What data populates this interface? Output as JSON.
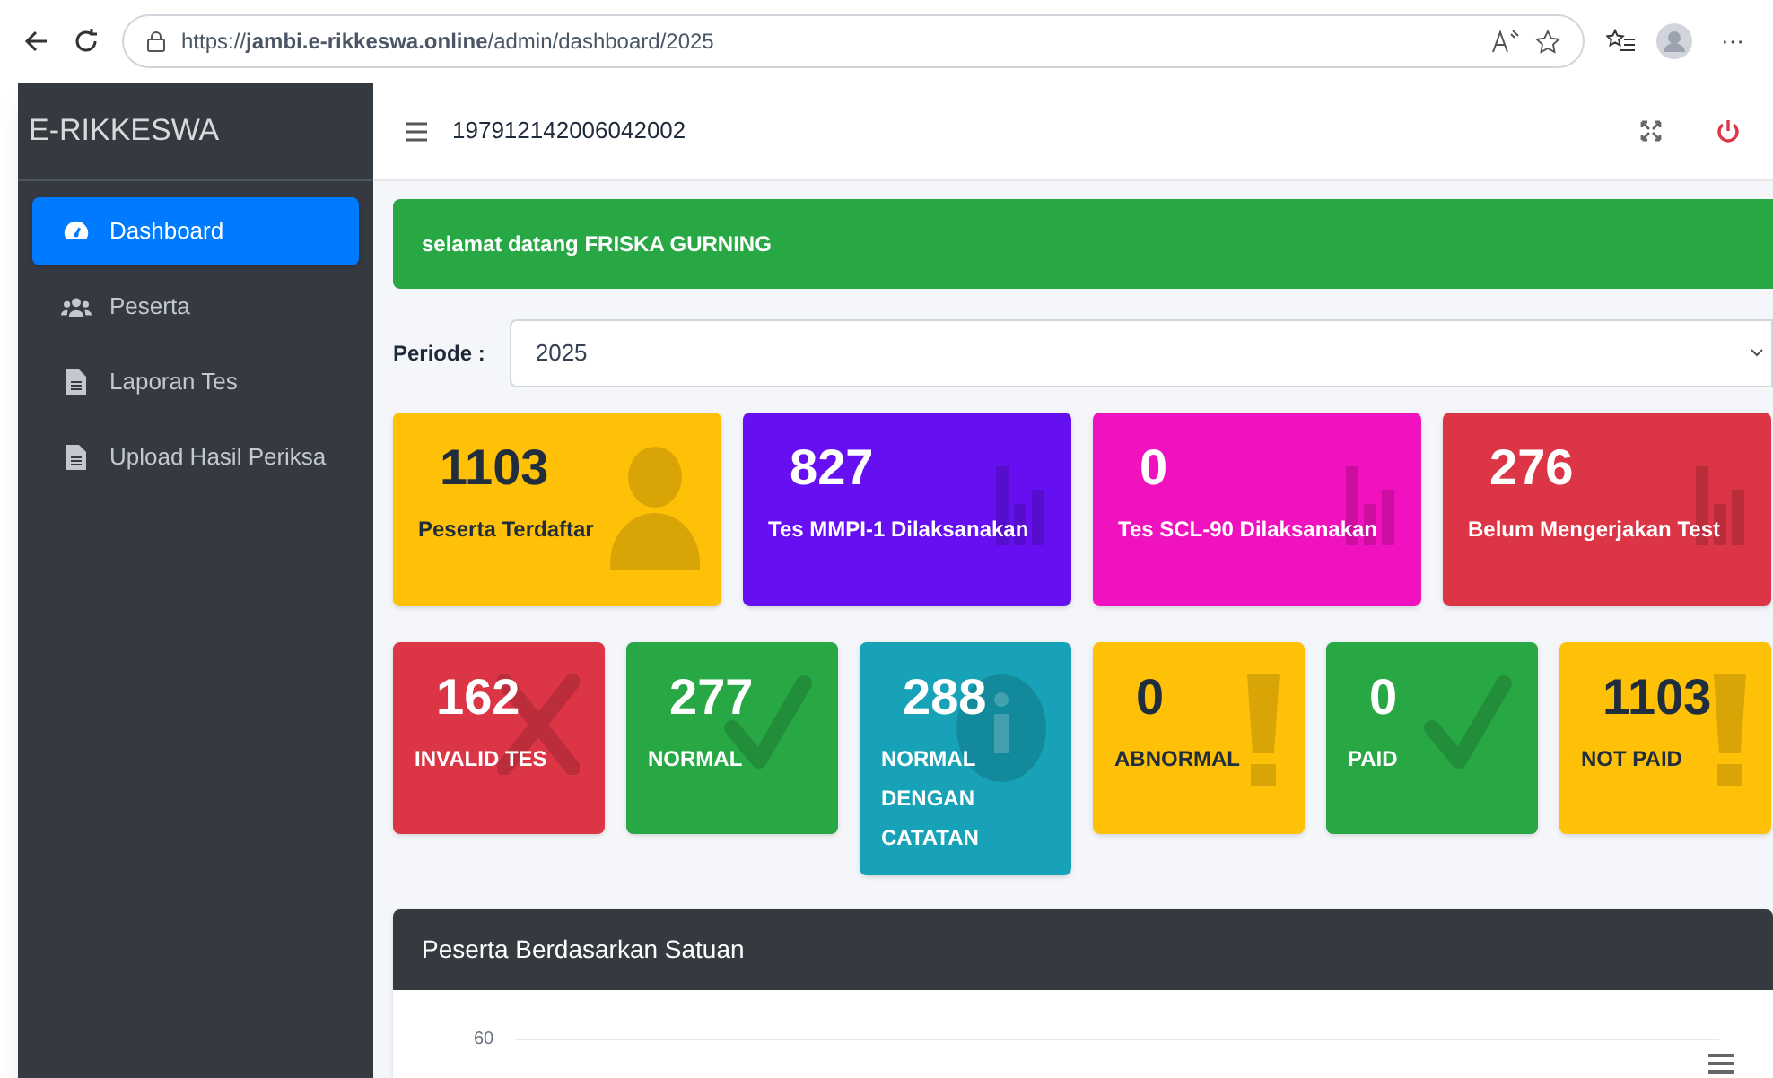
{
  "browser": {
    "url": "https://**jambi.e-rikkeswa.online**/admin/dashboard/2025",
    "more": "···"
  },
  "sidebar": {
    "brand": "E-RIKKESWA",
    "items": [
      {
        "label": "Dashboard",
        "kind": "gauge",
        "selected": true
      },
      {
        "label": "Peserta",
        "kind": "users",
        "selected": false
      },
      {
        "label": "Laporan Tes",
        "kind": "file",
        "selected": false
      },
      {
        "label": "Upload Hasil Periksa",
        "kind": "file",
        "selected": false
      }
    ]
  },
  "navbar": {
    "user_id": "197912142006042002"
  },
  "welcome": "selamat datang FRISKA GURNING",
  "periode": {
    "label": "Periode :",
    "value": "2025"
  },
  "stat_cards": [
    {
      "value": "1103",
      "label": "Peserta Terdaftar",
      "color": "#ffc107",
      "kind": "person"
    },
    {
      "value": "827",
      "label": "Tes MMPI-1 Dilaksanakan",
      "color": "#6610f2",
      "kind": "bars"
    },
    {
      "value": "0",
      "label": "Tes SCL-90 Dilaksanakan",
      "color": "#f012be",
      "kind": "bars"
    },
    {
      "value": "276",
      "label": "Belum Mengerjakan Test",
      "color": "#dc3545",
      "kind": "bars"
    }
  ],
  "result_cards": [
    {
      "value": "162",
      "label": "INVALID TES",
      "color": "#dc3545",
      "kind": "cross"
    },
    {
      "value": "277",
      "label": "NORMAL",
      "color": "#28a745",
      "kind": "check"
    },
    {
      "value": "288",
      "label": "NORMAL DENGAN CATATAN",
      "color": "#17a2b8",
      "kind": "info"
    },
    {
      "value": "0",
      "label": "ABNORMAL",
      "color": "#ffc107",
      "kind": "alert"
    },
    {
      "value": "0",
      "label": "PAID",
      "color": "#28a745",
      "kind": "check"
    },
    {
      "value": "1103",
      "label": "NOT PAID",
      "color": "#ffc107",
      "kind": "alert"
    }
  ],
  "chart_card": {
    "title": "Peserta Berdasarkan Satuan",
    "tick": "60"
  }
}
